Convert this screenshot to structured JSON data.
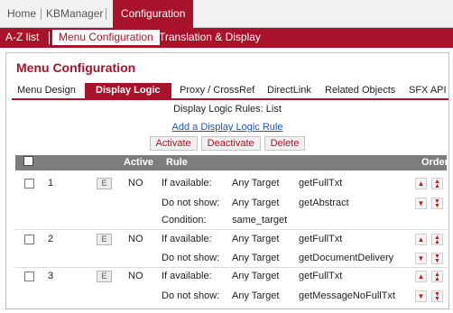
{
  "topnav": {
    "home": "Home",
    "kbmanager": "KBManager",
    "configuration": "Configuration"
  },
  "subnav": {
    "az": "A-Z list",
    "menu_config": "Menu Configuration",
    "translation": "Translation & Display"
  },
  "panel": {
    "title": "Menu Configuration"
  },
  "tabs": [
    "Menu Design",
    "Display Logic",
    "Proxy / CrossRef",
    "DirectLink",
    "Related Objects",
    "SFX API"
  ],
  "list": {
    "subtitle": "Display Logic Rules: List",
    "add_link": "Add a Display Logic Rule"
  },
  "actions": {
    "activate": "Activate",
    "deactivate": "Deactivate",
    "delete": "Delete"
  },
  "table": {
    "headers": {
      "active": "Active",
      "rule": "Rule",
      "order": "Order"
    },
    "edit_label": "E",
    "rows": [
      {
        "num": "1",
        "active": "NO",
        "lines": [
          {
            "cond": "If available:",
            "target": "Any Target",
            "service": "getFullTxt"
          },
          {
            "cond": "Do not show:",
            "target": "Any Target",
            "service": "getAbstract"
          },
          {
            "cond": "Condition:",
            "target": "same_target",
            "service": ""
          }
        ]
      },
      {
        "num": "2",
        "active": "NO",
        "lines": [
          {
            "cond": "If available:",
            "target": "Any Target",
            "service": "getFullTxt"
          },
          {
            "cond": "Do not show:",
            "target": "Any Target",
            "service": "getDocumentDelivery"
          }
        ]
      },
      {
        "num": "3",
        "active": "NO",
        "lines": [
          {
            "cond": "If available:",
            "target": "Any Target",
            "service": "getFullTxt"
          },
          {
            "cond": "Do not show:",
            "target": "Any Target",
            "service": "getMessageNoFullTxt"
          }
        ]
      }
    ]
  },
  "icons": {
    "up": "arrow-up-icon",
    "top": "double-arrow-up-icon",
    "down": "arrow-down-icon",
    "bottom": "double-arrow-down-icon"
  },
  "colors": {
    "brand": "#a8122a",
    "header_bg": "#7d7d7d",
    "link": "#1b54b8"
  }
}
